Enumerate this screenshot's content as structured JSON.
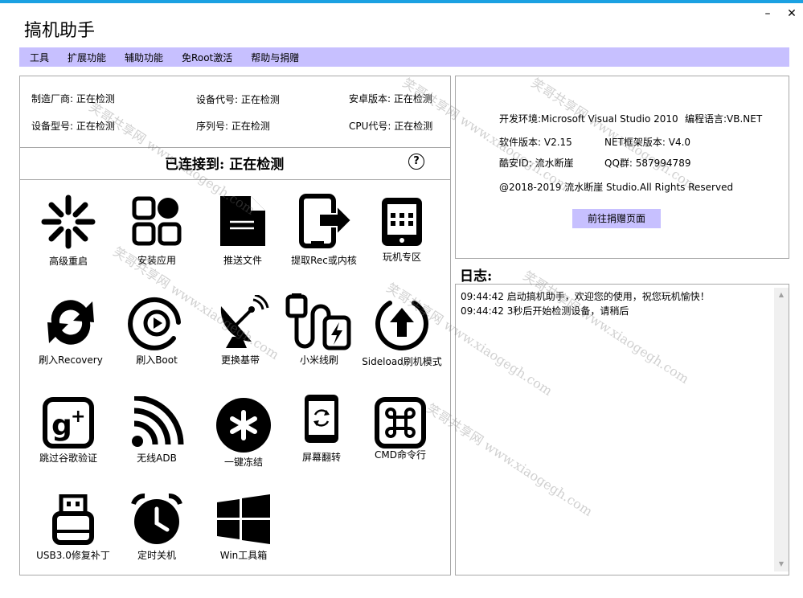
{
  "window": {
    "title": "搞机助手",
    "minimize": "–",
    "close": "✕"
  },
  "menu": [
    "工具",
    "扩展功能",
    "辅助功能",
    "免Root激活",
    "帮助与捐赠"
  ],
  "device_info": {
    "manufacturer": "制造厂商: 正在检测",
    "codename": "设备代号: 正在检测",
    "android_version": "安卓版本: 正在检测",
    "model": "设备型号: 正在检测",
    "serial": "序列号: 正在检测",
    "cpu": "CPU代号: 正在检测"
  },
  "connection": {
    "status": "已连接到: 正在检测",
    "help": "?"
  },
  "tools": [
    {
      "label": "高级重启",
      "icon": "advanced-reboot-icon"
    },
    {
      "label": "安装应用",
      "icon": "install-app-icon"
    },
    {
      "label": "推送文件",
      "icon": "push-file-icon"
    },
    {
      "label": "提取Rec或内核",
      "icon": "extract-rec-icon"
    },
    {
      "label": "玩机专区",
      "icon": "tablet-grid-icon"
    },
    {
      "label": "刷入Recovery",
      "icon": "flash-recovery-icon"
    },
    {
      "label": "刷入Boot",
      "icon": "flash-boot-icon"
    },
    {
      "label": "更换基带",
      "icon": "satellite-dish-icon"
    },
    {
      "label": "小米线刷",
      "icon": "usb-cable-icon"
    },
    {
      "label": "Sideload刷机模式",
      "icon": "sideload-icon"
    },
    {
      "label": "跳过谷歌验证",
      "icon": "google-plus-icon"
    },
    {
      "label": "无线ADB",
      "icon": "wifi-icon"
    },
    {
      "label": "一键冻结",
      "icon": "freeze-icon"
    },
    {
      "label": "屏幕翻转",
      "icon": "screen-rotate-icon"
    },
    {
      "label": "CMD命令行",
      "icon": "command-key-icon"
    },
    {
      "label": "USB3.0修复补丁",
      "icon": "usb-drive-icon"
    },
    {
      "label": "定时关机",
      "icon": "alarm-clock-icon"
    },
    {
      "label": "Win工具箱",
      "icon": "windows-logo-icon"
    }
  ],
  "about": {
    "env": "开发环境:Microsoft Visual Studio 2010",
    "lang": "编程语言:VB.NET",
    "version": "软件版本: V2.15",
    "net": "NET框架版本: V4.0",
    "coolapk": "酷安ID: 流水断崖",
    "qq": "QQ群: 587994789",
    "copyright": "@2018-2019  流水断崖 Studio.All Rights Reserved",
    "donate_button": "前往捐赠页面"
  },
  "log": {
    "title": "日志:",
    "lines": [
      "09:44:42 启动搞机助手，欢迎您的使用，祝您玩机愉快！",
      "09:44:42 3秒后开始检测设备，请稍后"
    ],
    "scroll_up": "▲",
    "scroll_down": "▼"
  },
  "watermarks": [
    "笑哥共享网 www.xiaogegh.com",
    "笑哥共享网 www.xiaogegh.com",
    "笑哥共享网 www.xiaogegh.com",
    "笑哥共享网 www.xiaogegh.com",
    "笑哥共享网 www.xiaogegh.com",
    "笑哥共享网 www.xiaogegh.com",
    "笑哥共享网 www.xiaogegh.com"
  ]
}
